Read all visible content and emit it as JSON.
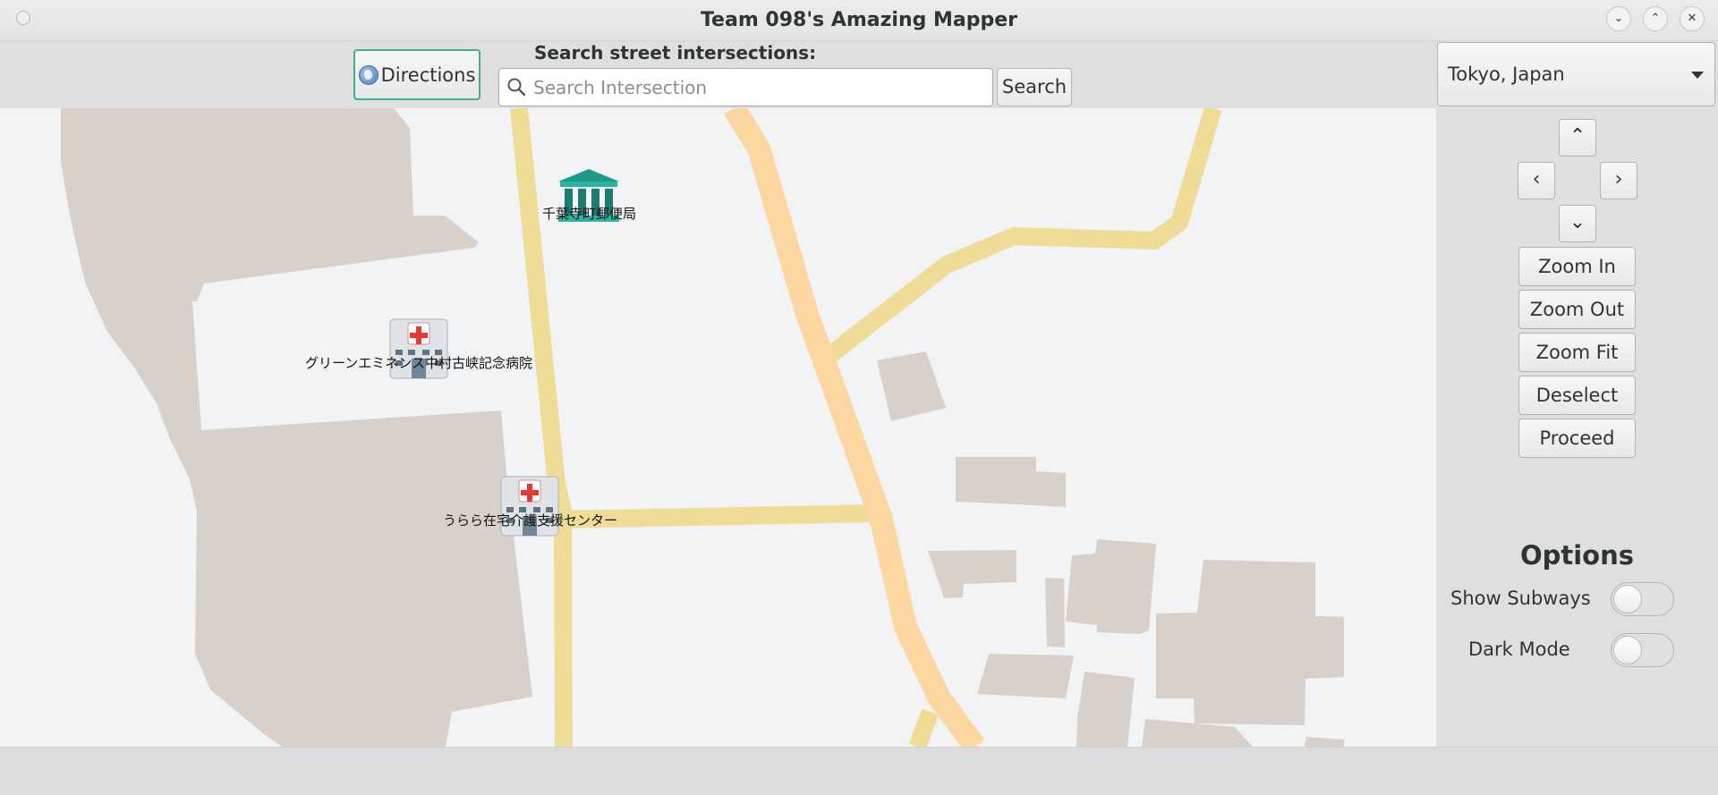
{
  "window": {
    "title": "Team 098's Amazing Mapper",
    "controls": [
      "minimize-icon",
      "maximize-icon",
      "close-icon"
    ]
  },
  "toolbar": {
    "directions_label": "Directions",
    "search_label": "Search street intersections:",
    "search_placeholder": "Search Intersection",
    "search_value": "",
    "search_button": "Search"
  },
  "map_selector": {
    "selected": "Tokyo, Japan"
  },
  "navigation": {
    "up": "up-chevron-icon",
    "left": "left-chevron-icon",
    "right": "right-chevron-icon",
    "down": "down-chevron-icon"
  },
  "actions": {
    "zoom_in": "Zoom In",
    "zoom_out": "Zoom Out",
    "zoom_fit": "Zoom Fit",
    "deselect": "Deselect",
    "proceed": "Proceed"
  },
  "options": {
    "title": "Options",
    "show_subways": {
      "label": "Show Subways",
      "on": false
    },
    "dark_mode": {
      "label": "Dark Mode",
      "on": false
    }
  },
  "map": {
    "pois": [
      {
        "name": "千葉寺町郵便局",
        "icon": "post-office-icon"
      },
      {
        "name": "グリーンエミネンス中村古峡記念病院",
        "icon": "hospital-icon"
      },
      {
        "name": "うらら在宅介護支援センター",
        "icon": "hospital-icon"
      }
    ],
    "colors": {
      "background": "#f1f3f4",
      "building": "#d9d0c9",
      "major_road": "#fdd7a1",
      "minor_road": "#efdd97"
    }
  }
}
